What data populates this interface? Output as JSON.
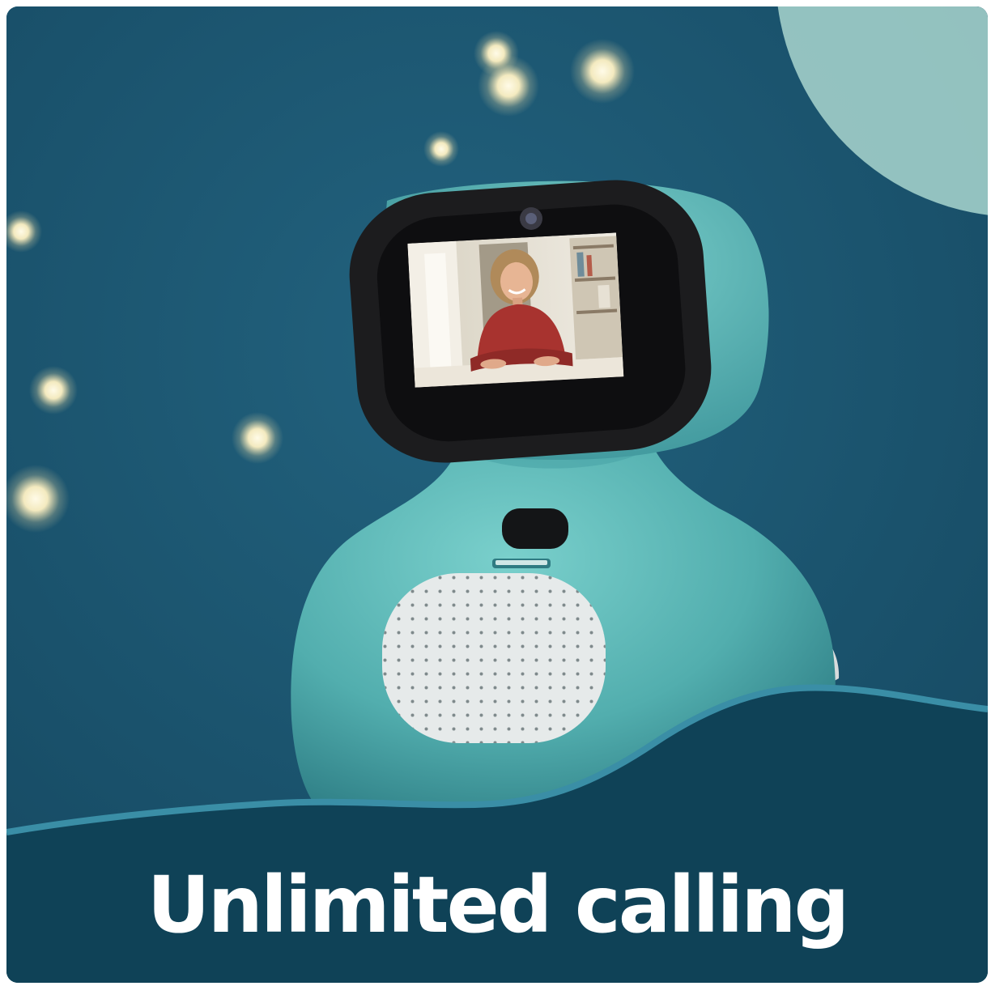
{
  "caption": "Unlimited calling",
  "colors": {
    "background": "#1d5672",
    "robot_body": "#5fb8b6",
    "screen_bezel": "#1c1c1e",
    "speaker_grille": "#e6eaea",
    "foreground_wave": "#0f4257",
    "wave_rim": "#3a8ea6",
    "moon": "#a9d6cf",
    "caption_text": "#ffffff"
  },
  "icons": [
    "robot-device",
    "video-call-screen",
    "speaker-grille",
    "bokeh-light",
    "moon"
  ]
}
